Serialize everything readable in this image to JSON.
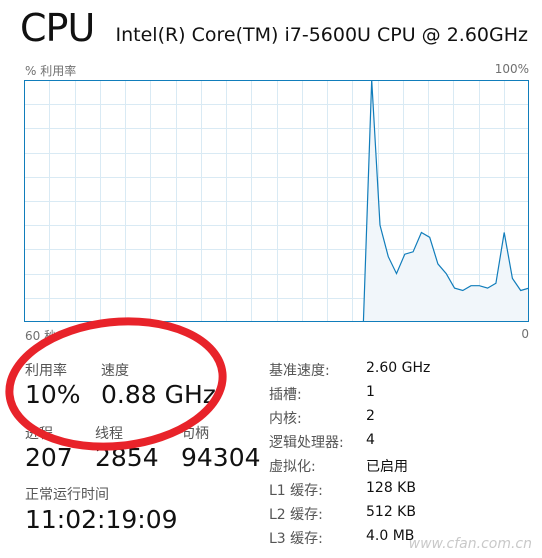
{
  "header": {
    "title": "CPU",
    "processor": "Intel(R) Core(TM) i7-5600U CPU @ 2.60GHz"
  },
  "graph": {
    "y_label": "% 利用率",
    "y_max_label": "100%",
    "x_left_label": "60 秒",
    "x_right_label": "0",
    "line_color": "#117dbb",
    "fill_color": "#f1f6fa",
    "grid_color": "#d9eaf4",
    "series": [
      0,
      0,
      0,
      0,
      0,
      0,
      0,
      0,
      0,
      0,
      0,
      0,
      0,
      0,
      0,
      0,
      0,
      0,
      0,
      0,
      0,
      0,
      0,
      0,
      0,
      0,
      0,
      0,
      0,
      0,
      0,
      0,
      0,
      0,
      0,
      0,
      0,
      0,
      0,
      0,
      0,
      0,
      100,
      40,
      27,
      20,
      28,
      29,
      37,
      35,
      24,
      20,
      14,
      13,
      15,
      15,
      14,
      16,
      37,
      18,
      13,
      14
    ]
  },
  "stats": {
    "utilization": {
      "label": "利用率",
      "value": "10%"
    },
    "speed": {
      "label": "速度",
      "value": "0.88 GHz"
    },
    "processes": {
      "label": "进程",
      "value": "207"
    },
    "threads": {
      "label": "线程",
      "value": "2854"
    },
    "handles": {
      "label": "句柄",
      "value": "94304"
    },
    "uptime": {
      "label": "正常运行时间",
      "value": "11:02:19:09"
    }
  },
  "details": [
    {
      "label": "基准速度:",
      "value": "2.60 GHz"
    },
    {
      "label": "插槽:",
      "value": "1"
    },
    {
      "label": "内核:",
      "value": "2"
    },
    {
      "label": "逻辑处理器:",
      "value": "4"
    },
    {
      "label": "虚拟化:",
      "value": "已启用"
    },
    {
      "label": "L1 缓存:",
      "value": "128 KB"
    },
    {
      "label": "L2 缓存:",
      "value": "512 KB"
    },
    {
      "label": "L3 缓存:",
      "value": "4.0 MB"
    }
  ],
  "annotation_color": "#e8232a",
  "watermark": "www.cfan.com.cn"
}
